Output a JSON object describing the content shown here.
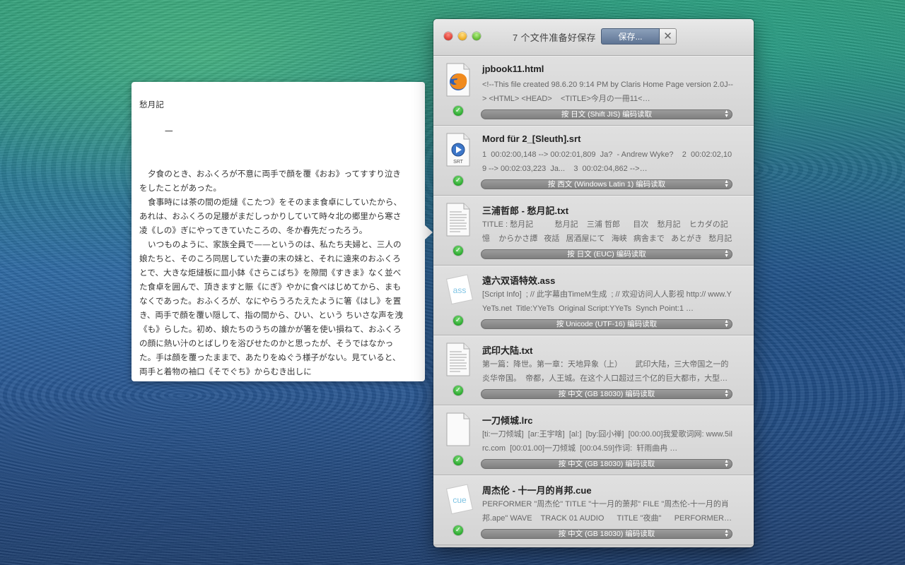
{
  "preview": {
    "title": "愁月記",
    "section": "一",
    "paragraphs": [
      "夕食のとき、おふくろが不意に両手で顔を覆《おお》ってすすり泣きをしたことがあった。",
      "食事時には茶の間の炬燵《こたつ》をそのまま食卓にしていたから、あれは、おふくろの足腰がまだしっかりしていて時々北の郷里から寒さ凌《しの》ぎにやってきていたころの、冬か春先だったろう。",
      "いつものように、家族全員で——というのは、私たち夫婦と、三人の娘たちと、そのころ同居していた妻の末の妹と、それに遠来のおふくろとで、大きな炬燵板に皿小鉢《さらこばち》を隙間《すきま》なく並べた食卓を囲んで、頂きますと賑《にぎ》やかに食べはじめてから、まもなくであった。おふくろが、なにやらうろたえたように箸《はし》を置き、両手で顔を覆い隠して、指の間から、ひい、という ちいさな声を洩《も》らした。初め、娘たちのうちの誰かが箸を使い損ねて、おふくろの顔に熱い汁のとばしりを浴びせたのかと思ったが、そうではなかった。手は顔を覆ったままで、あたりをぬぐう様子がない。見ていると、両手と着物の袖口《そでぐち》からむき出しに"
    ]
  },
  "window": {
    "status": "7 个文件准备好保存",
    "save_label": "保存...",
    "cancel_label": "✕"
  },
  "files": [
    {
      "name": "jpbook11.html",
      "icon": "firefox-html-icon",
      "snippet": "<!--This file created 98.6.20 9:14 PM by Claris Home Page version 2.0J--> <HTML> <HEAD>    <TITLE>今月の一冊11<…",
      "encoding": "按 日文 (Shift JIS) 编码读取"
    },
    {
      "name": "Mord für 2_[Sleuth].srt",
      "icon": "srt-file-icon",
      "icon_label": "SRT",
      "snippet": "1  00:02:00,148 --> 00:02:01,809  Ja?  - Andrew Wyke?    2  00:02:02,109 --> 00:02:03,223  Ja...    3  00:02:04,862 -->…",
      "encoding": "按 西文 (Windows Latin 1) 编码读取"
    },
    {
      "name": "三浦哲郎 - 愁月記.txt",
      "icon": "text-document-icon",
      "snippet": "TITLE : 愁月記          愁月記    三浦 哲郎      目次    愁月記    ヒカダの記憶    からかさ譚   夜話   居酒屋にて   海峡   病舎まで   あとがき   愁月記     …",
      "encoding": "按 日文 (EUC) 编码读取"
    },
    {
      "name": "遠六双语特效.ass",
      "icon": "ass-file-icon",
      "icon_label": "ass",
      "snippet": "[Script Info]  ; // 此字幕由TimeM生成  ; // 欢迎访问人人影视 http:// www.YYeTs.net  Title:YYeTs  Original Script:YYeTs  Synch Point:1 …",
      "encoding": "按 Unicode (UTF-16) 编码读取"
    },
    {
      "name": "武印大陆.txt",
      "icon": "text-document-icon",
      "snippet": "第一篇：降世。第一章：天地异象（上）      武印大陆，三大帝国之一的炎华帝国。  帝都，人王城。在这个人口超过三个亿的巨大都市，大型…",
      "encoding": "按 中文 (GB 18030) 编码读取"
    },
    {
      "name": "一刀倾城.lrc",
      "icon": "blank-document-icon",
      "snippet": "[ti:一刀倾城]  [ar:王宇啥]  [al:]  [by:囧小禅]  [00:00.00]我爱歌词网: www.5ilrc.com  [00:01.00]一刀倾城  [00:04.59]作词:  轩雨曲冉 …",
      "encoding": "按 中文 (GB 18030) 编码读取"
    },
    {
      "name": "周杰伦 - 十一月的肖邦.cue",
      "icon": "cue-file-icon",
      "icon_label": "cue",
      "snippet": "PERFORMER \"周杰伦\" TITLE \"十一月的萧邦\" FILE \"周杰伦-十一月的肖邦.ape\" WAVE    TRACK 01 AUDIO      TITLE \"夜曲\"      PERFORMER…",
      "encoding": "按 中文 (GB 18030) 编码读取"
    }
  ]
}
